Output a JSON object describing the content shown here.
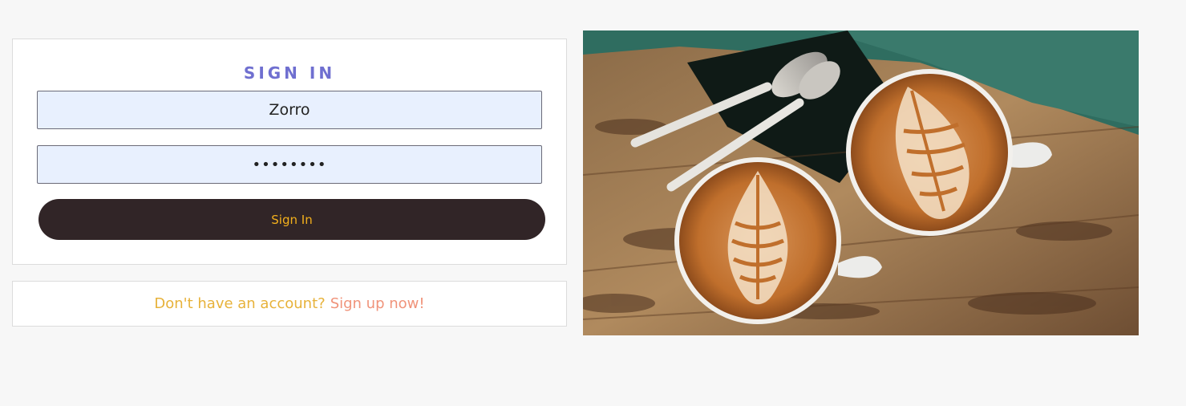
{
  "login": {
    "title": "SIGN IN",
    "username_value": "Zorro",
    "password_value": "••••••••",
    "submit_label": "Sign In"
  },
  "signup": {
    "prompt": "Don't have an account?",
    "link_label": "Sign up now!"
  },
  "colors": {
    "title": "#6f6fd0",
    "button_bg": "#312527",
    "button_text": "#f3b01c",
    "prompt_text": "#e7b23a",
    "link_text": "#f0937a",
    "input_bg": "#e8f0fe"
  }
}
